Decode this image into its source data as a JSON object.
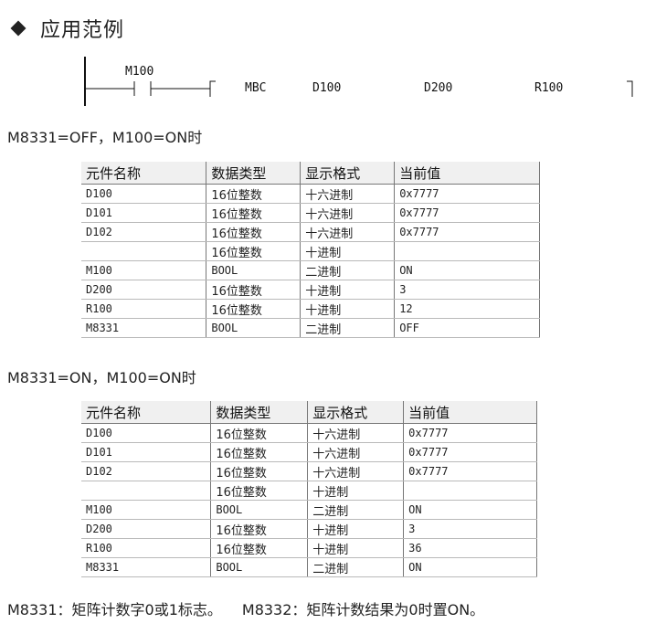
{
  "heading": "应用范例",
  "ladder": {
    "contact": "M100",
    "instruction": "MBC",
    "operand1": "D100",
    "operand2": "D200",
    "operand3": "R100"
  },
  "case1": {
    "condition": "M8331=OFF，M100=ON时",
    "headers": [
      "元件名称",
      "数据类型",
      "显示格式",
      "当前值"
    ],
    "rows": [
      [
        "D100",
        "16位整数",
        "十六进制",
        "0x7777"
      ],
      [
        "D101",
        "16位整数",
        "十六进制",
        "0x7777"
      ],
      [
        "D102",
        "16位整数",
        "十六进制",
        "0x7777"
      ],
      [
        "",
        "16位整数",
        "十进制",
        ""
      ],
      [
        "M100",
        "BOOL",
        "二进制",
        "ON"
      ],
      [
        "D200",
        "16位整数",
        "十进制",
        "3"
      ],
      [
        "R100",
        "16位整数",
        "十进制",
        "12"
      ],
      [
        "M8331",
        "BOOL",
        "二进制",
        "OFF"
      ]
    ]
  },
  "case2": {
    "condition": "M8331=ON，M100=ON时",
    "headers": [
      "元件名称",
      "数据类型",
      "显示格式",
      "当前值"
    ],
    "rows": [
      [
        "D100",
        "16位整数",
        "十六进制",
        "0x7777"
      ],
      [
        "D101",
        "16位整数",
        "十六进制",
        "0x7777"
      ],
      [
        "D102",
        "16位整数",
        "十六进制",
        "0x7777"
      ],
      [
        "",
        "16位整数",
        "十进制",
        ""
      ],
      [
        "M100",
        "BOOL",
        "二进制",
        "ON"
      ],
      [
        "D200",
        "16位整数",
        "十进制",
        "3"
      ],
      [
        "R100",
        "16位整数",
        "十进制",
        "36"
      ],
      [
        "M8331",
        "BOOL",
        "二进制",
        "ON"
      ]
    ]
  },
  "notes": [
    "M8331：矩阵计数字0或1标志。",
    "M8332：矩阵计数结果为0时置ON。"
  ]
}
